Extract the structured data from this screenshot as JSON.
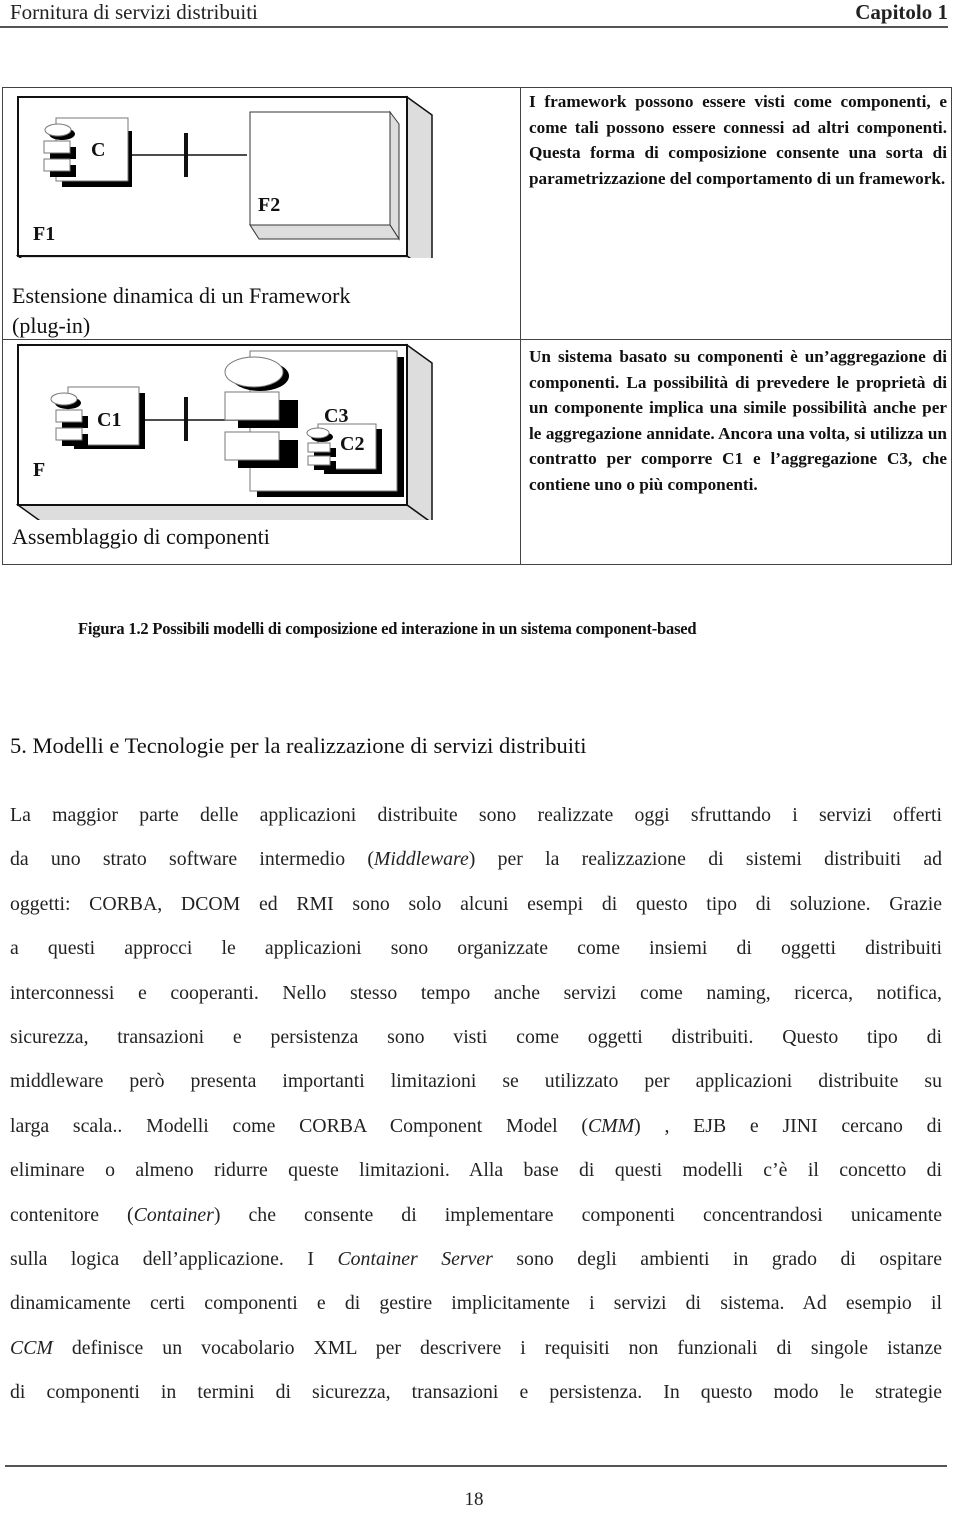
{
  "header": {
    "left": "Fornitura di servizi distribuiti",
    "right": "Capitolo 1"
  },
  "figure": {
    "panels": [
      {
        "diagram_labels": {
          "outer_framework": "F1",
          "component": "C",
          "inner_framework": "F2"
        },
        "caption": [
          "Estensione dinamica di un Framework",
          "(plug-in)"
        ],
        "description": "I framework possono essere visti come componenti, e come tali possono essere connessi ad altri componenti. Questa forma di composizione consente una sorta di parametrizzazione del comportamento di un framework."
      },
      {
        "diagram_labels": {
          "framework": "F",
          "component1": "C1",
          "aggregate": "C3",
          "component2": "C2"
        },
        "caption": [
          "Assemblaggio di componenti"
        ],
        "description": "Un sistema basato su componenti è un’aggregazione di componenti. La possibilità di prevedere le proprietà di un componente implica una simile possibilità anche per le aggregazione annidate. Ancora una volta, si utilizza un contratto per comporre C1 e l’aggregazione C3, che contiene uno o più componenti."
      }
    ],
    "caption": "Figura 1.2 Possibili modelli di composizione ed interazione in un sistema component-based"
  },
  "section": {
    "title": "5. Modelli e Tecnologie per la realizzazione di servizi distribuiti",
    "lines": [
      "La maggior parte delle applicazioni distribuite sono realizzate oggi sfruttando i servizi offerti",
      "da uno strato software intermedio (Middleware) per la realizzazione di sistemi distribuiti ad",
      "oggetti: CORBA, DCOM ed RMI sono solo alcuni esempi di questo tipo di soluzione. Grazie",
      "a questi approcci le applicazioni sono organizzate come insiemi di oggetti distribuiti",
      "interconnessi e cooperanti. Nello stesso tempo anche servizi come naming, ricerca, notifica,",
      "sicurezza, transazioni e persistenza sono visti come oggetti distribuiti. Questo tipo di",
      "middleware però presenta importanti limitazioni se utilizzato per  applicazioni distribuite su",
      "larga scala.. Modelli come CORBA Component Model (CMM) , EJB e JINI cercano di",
      "eliminare o almeno ridurre queste limitazioni. Alla base di questi modelli c’è il concetto di",
      "contenitore (Container) che consente di implementare componenti concentrandosi unicamente",
      "sulla logica dell’applicazione. I Container Server sono degli ambienti in grado di ospitare",
      "dinamicamente certi componenti e di gestire implicitamente i servizi di sistema. Ad esempio il",
      "CCM definisce un vocabolario XML per descrivere i requisiti non funzionali di singole istanze",
      "di componenti in termini di sicurezza, transazioni e persistenza. In questo modo le strategie"
    ],
    "italic_terms": [
      "Middleware",
      "CMM",
      "Container",
      "Container Server",
      "CCM"
    ]
  },
  "footer": {
    "page_number": "18"
  }
}
